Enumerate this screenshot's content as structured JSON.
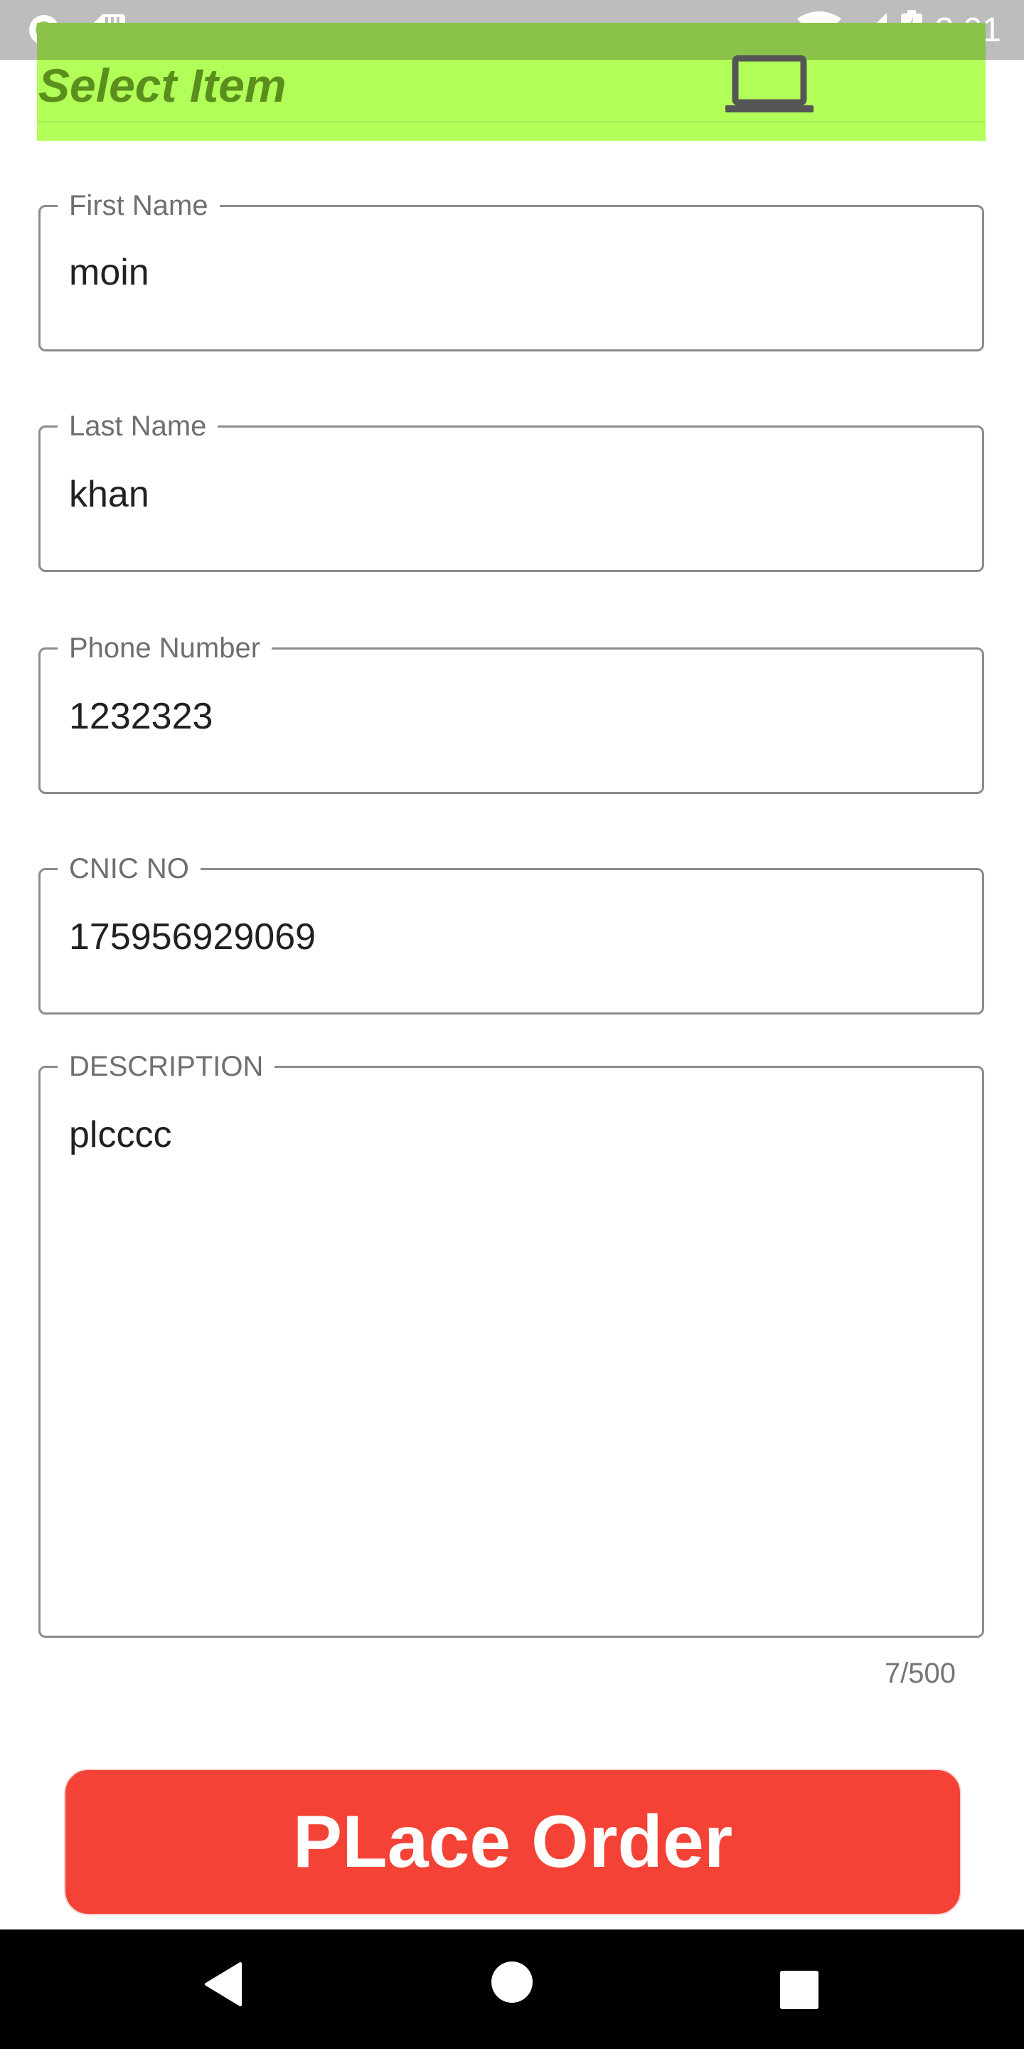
{
  "status_bar": {
    "time": "3:01",
    "icons": [
      "record-icon",
      "sd-card-icon",
      "wifi-icon",
      "cell-signal-icon",
      "battery-charging-icon"
    ]
  },
  "header": {
    "title": "Select Item",
    "icon": "laptop-icon"
  },
  "form": {
    "first_name": {
      "label": "First Name",
      "value": "moin"
    },
    "last_name": {
      "label": "Last Name",
      "value": "khan"
    },
    "phone": {
      "label": "Phone Number",
      "value": "1232323"
    },
    "cnic": {
      "label": "CNIC NO",
      "value": "175956929069"
    },
    "description": {
      "label": "DESCRIPTION",
      "value": "plcccc",
      "counter": "7/500"
    }
  },
  "actions": {
    "place_order_label": "PLace Order"
  },
  "nav": {
    "icons": [
      "back-icon",
      "home-icon",
      "recents-icon"
    ]
  },
  "colors": {
    "header_bg": "#b2ff59",
    "header_title": "#5a8f1e",
    "button_bg": "#f44336",
    "status_bar_bg": "#bdbdbd",
    "nav_bar_bg": "#000000"
  }
}
